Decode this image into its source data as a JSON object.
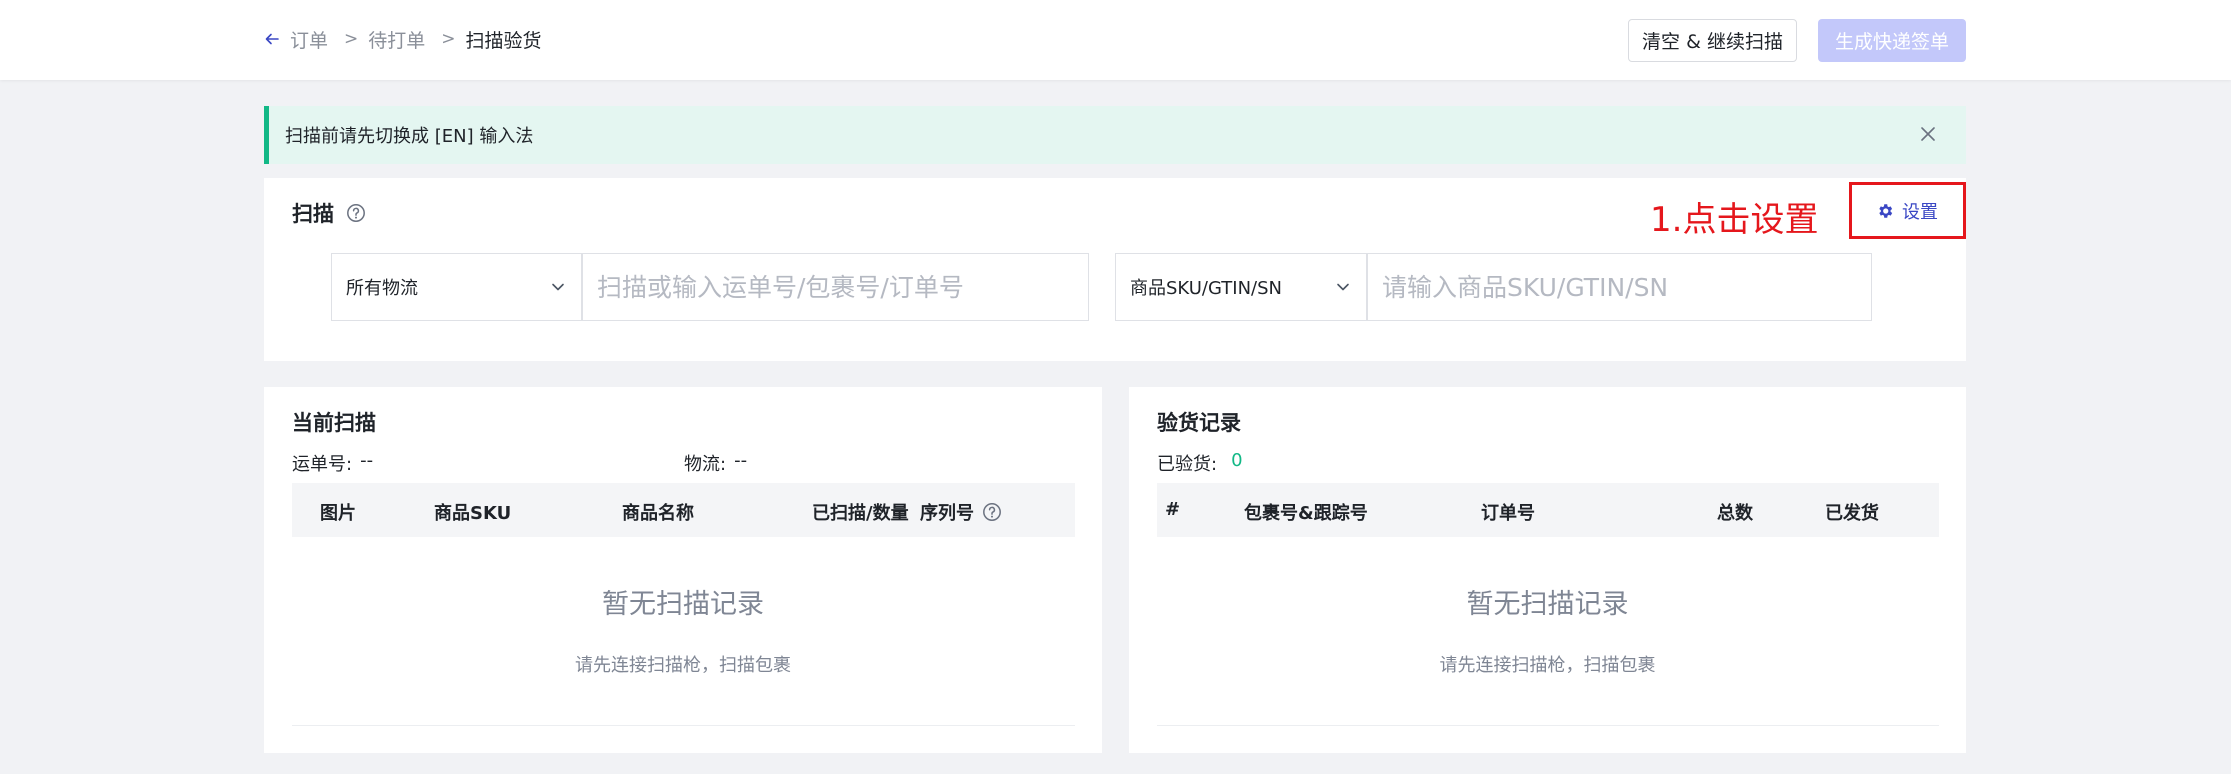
{
  "header": {
    "breadcrumb": {
      "orders": "订单",
      "pending": "待打单",
      "current": "扫描验货",
      "sep": ">"
    },
    "clear_button": "清空 & 继续扫描",
    "generate_button": "生成快递签单"
  },
  "alert": {
    "text": "扫描前请先切换成 [EN] 输入法"
  },
  "scan": {
    "title": "扫描",
    "annotation": "1.点击设置",
    "settings_label": "设置",
    "logistics_select": "所有物流",
    "tracking_placeholder": "扫描或输入运单号/包裹号/订单号",
    "sku_select": "商品SKU/GTIN/SN",
    "sku_placeholder": "请输入商品SKU/GTIN/SN"
  },
  "current_scan": {
    "title": "当前扫描",
    "waybill_label": "运单号:",
    "waybill_value": "--",
    "logistics_label": "物流:",
    "logistics_value": "--",
    "columns": [
      "图片",
      "商品SKU",
      "商品名称",
      "已扫描/数量",
      "序列号"
    ],
    "empty_title": "暂无扫描记录",
    "empty_sub": "请先连接扫描枪，扫描包裹"
  },
  "inspection_records": {
    "title": "验货记录",
    "inspected_label": "已验货:",
    "inspected_value": "0",
    "columns": [
      "#",
      "包裹号&跟踪号",
      "订单号",
      "总数",
      "已发货"
    ],
    "empty_title": "暂无扫描记录",
    "empty_sub": "请先连接扫描枪，扫描包裹"
  },
  "colors": {
    "accent": "#3a47c4",
    "disabled_primary": "#c3c8fa",
    "alert_bg": "#e4f6f1",
    "alert_border": "#12b886",
    "annotation_red": "#e5171c"
  }
}
